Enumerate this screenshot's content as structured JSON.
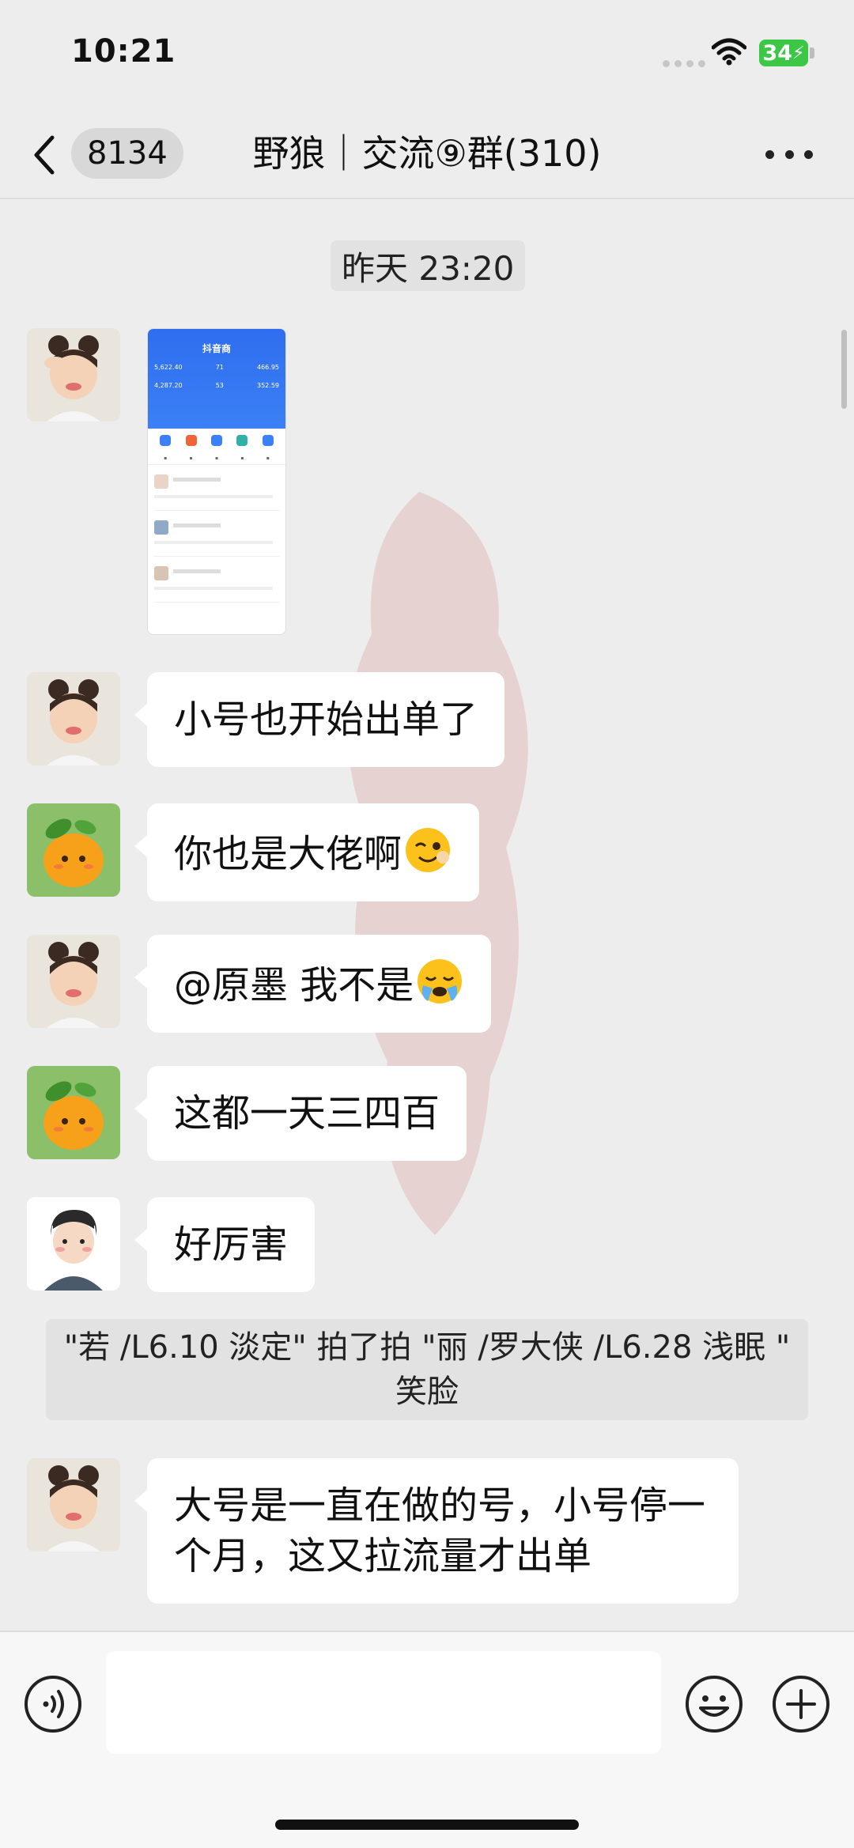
{
  "status_bar": {
    "time": "10:21",
    "battery": "34"
  },
  "header": {
    "unread_count": "8134",
    "title": "野狼｜交流⑨群(310)"
  },
  "chat": {
    "timestamp": "昨天 23:20",
    "messages": [
      {
        "sender_avatar": "girl-avatar",
        "type": "image"
      },
      {
        "sender_avatar": "girl-avatar",
        "type": "text",
        "text": "小号也开始出单了"
      },
      {
        "sender_avatar": "orange-avatar",
        "type": "text",
        "text": "你也是大佬啊",
        "emoji": "wink-emoji"
      },
      {
        "sender_avatar": "girl-avatar",
        "type": "text",
        "text": "@原墨 我不是",
        "emoji": "facepalm-emoji"
      },
      {
        "sender_avatar": "orange-avatar",
        "type": "text",
        "text": "这都一天三四百"
      },
      {
        "sender_avatar": "boy-avatar",
        "type": "text",
        "text": "好厉害"
      },
      {
        "sender_avatar": "girl-avatar",
        "type": "text",
        "text": "大号是一直在做的号，小号停一个月，这又拉流量才出单"
      }
    ],
    "system_note": "\"若 /L6.10 淡定\" 拍了拍 \"丽 /罗大侠 /L6.28 浅眠 \" 笑脸"
  },
  "thumbnail": {
    "app_title": "抖音商",
    "stats_row1": [
      "5,622.40",
      "71",
      "466.95"
    ],
    "stats_row2": [
      "4,287.20",
      "53",
      "352.59"
    ]
  },
  "colors": {
    "background": "#ededed",
    "bubble": "#ffffff",
    "battery": "#3cc846",
    "thumbnail_header": "#2f6ef0"
  }
}
